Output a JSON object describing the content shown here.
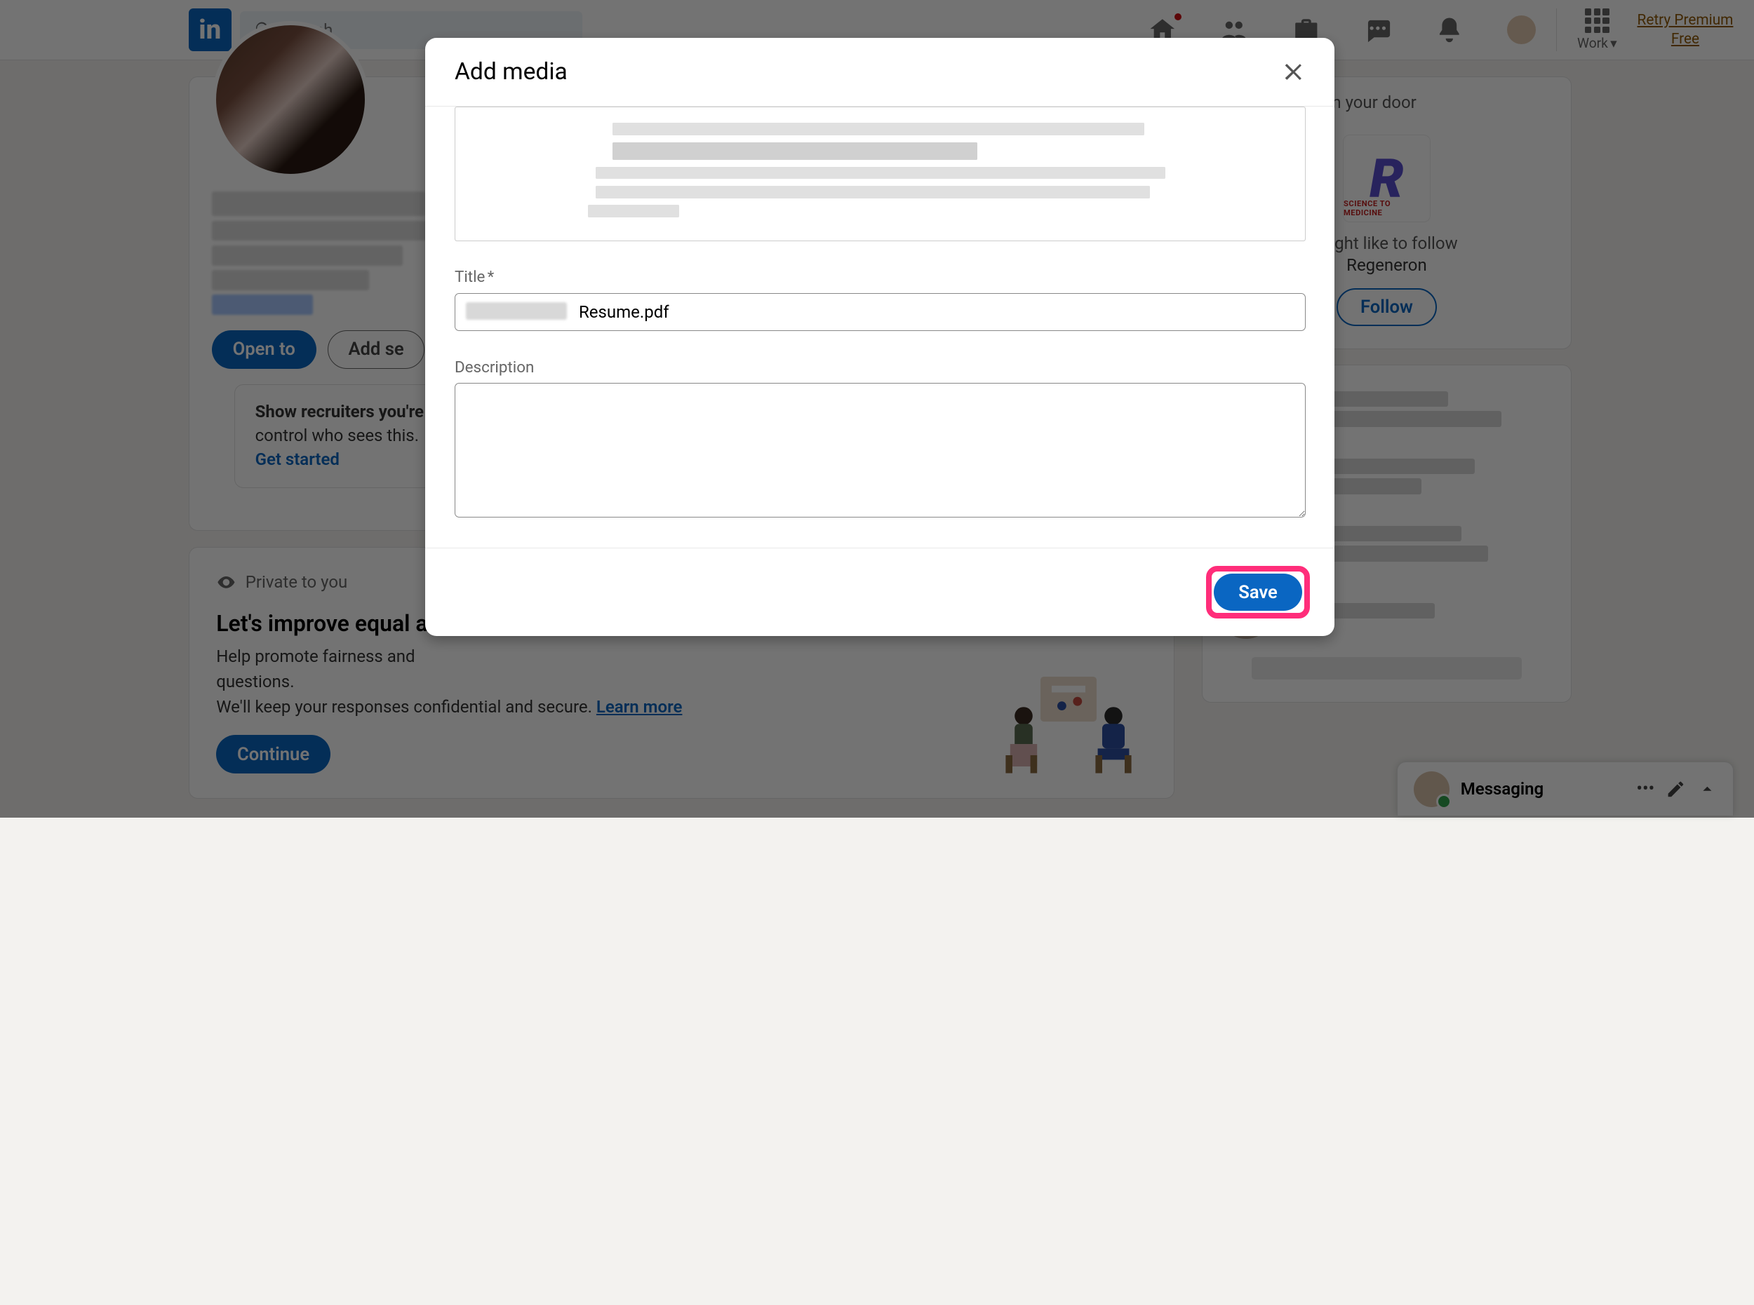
{
  "nav": {
    "search_placeholder": "Search",
    "work_label": "Work",
    "retry_premium_l1": "Retry Premium",
    "retry_premium_l2": "Free"
  },
  "profile": {
    "open_to": "Open to",
    "add_section": "Add se",
    "recruiter_bold": "Show recruiters you're",
    "recruiter_tail": "control who sees this.",
    "recruiter_link": "Get started"
  },
  "private_card": {
    "badge": "Private to you",
    "heading": "Let's improve equal ac",
    "line1": "Help promote fairness and",
    "questions": "questions.",
    "line2a": "We'll keep your responses confidential and secure. ",
    "learn_more": "Learn more",
    "continue": "Continue"
  },
  "side": {
    "banner_tail": "are knocking on your door",
    "follow_head": "might like to follow",
    "company_name": "Regeneron",
    "follow_btn": "Follow"
  },
  "modal": {
    "title": "Add media",
    "title_label": "Title",
    "required_mark": "*",
    "title_value": "Resume.pdf",
    "desc_label": "Description",
    "desc_value": "",
    "save": "Save"
  },
  "messaging": {
    "label": "Messaging"
  }
}
